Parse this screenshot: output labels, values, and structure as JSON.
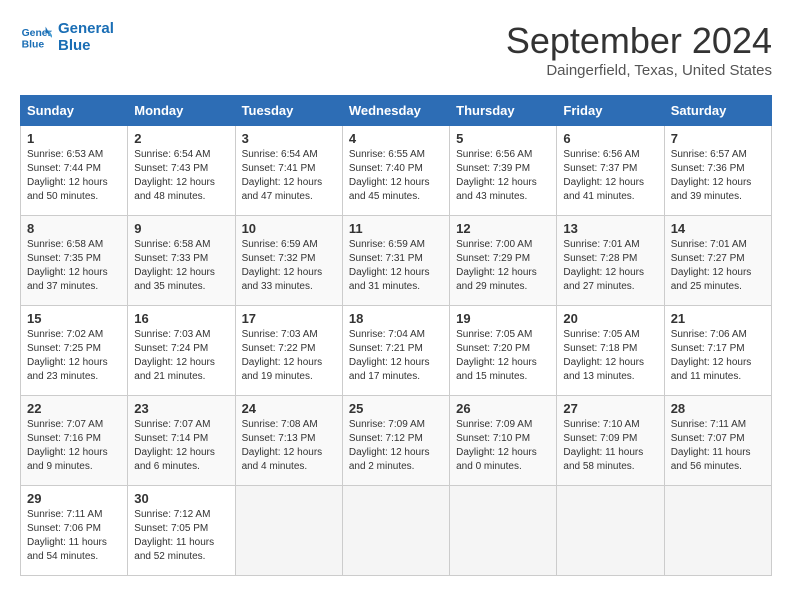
{
  "header": {
    "logo_line1": "General",
    "logo_line2": "Blue",
    "month_year": "September 2024",
    "location": "Daingerfield, Texas, United States"
  },
  "weekdays": [
    "Sunday",
    "Monday",
    "Tuesday",
    "Wednesday",
    "Thursday",
    "Friday",
    "Saturday"
  ],
  "weeks": [
    [
      {
        "day": "1",
        "sunrise": "Sunrise: 6:53 AM",
        "sunset": "Sunset: 7:44 PM",
        "daylight": "Daylight: 12 hours and 50 minutes."
      },
      {
        "day": "2",
        "sunrise": "Sunrise: 6:54 AM",
        "sunset": "Sunset: 7:43 PM",
        "daylight": "Daylight: 12 hours and 48 minutes."
      },
      {
        "day": "3",
        "sunrise": "Sunrise: 6:54 AM",
        "sunset": "Sunset: 7:41 PM",
        "daylight": "Daylight: 12 hours and 47 minutes."
      },
      {
        "day": "4",
        "sunrise": "Sunrise: 6:55 AM",
        "sunset": "Sunset: 7:40 PM",
        "daylight": "Daylight: 12 hours and 45 minutes."
      },
      {
        "day": "5",
        "sunrise": "Sunrise: 6:56 AM",
        "sunset": "Sunset: 7:39 PM",
        "daylight": "Daylight: 12 hours and 43 minutes."
      },
      {
        "day": "6",
        "sunrise": "Sunrise: 6:56 AM",
        "sunset": "Sunset: 7:37 PM",
        "daylight": "Daylight: 12 hours and 41 minutes."
      },
      {
        "day": "7",
        "sunrise": "Sunrise: 6:57 AM",
        "sunset": "Sunset: 7:36 PM",
        "daylight": "Daylight: 12 hours and 39 minutes."
      }
    ],
    [
      {
        "day": "8",
        "sunrise": "Sunrise: 6:58 AM",
        "sunset": "Sunset: 7:35 PM",
        "daylight": "Daylight: 12 hours and 37 minutes."
      },
      {
        "day": "9",
        "sunrise": "Sunrise: 6:58 AM",
        "sunset": "Sunset: 7:33 PM",
        "daylight": "Daylight: 12 hours and 35 minutes."
      },
      {
        "day": "10",
        "sunrise": "Sunrise: 6:59 AM",
        "sunset": "Sunset: 7:32 PM",
        "daylight": "Daylight: 12 hours and 33 minutes."
      },
      {
        "day": "11",
        "sunrise": "Sunrise: 6:59 AM",
        "sunset": "Sunset: 7:31 PM",
        "daylight": "Daylight: 12 hours and 31 minutes."
      },
      {
        "day": "12",
        "sunrise": "Sunrise: 7:00 AM",
        "sunset": "Sunset: 7:29 PM",
        "daylight": "Daylight: 12 hours and 29 minutes."
      },
      {
        "day": "13",
        "sunrise": "Sunrise: 7:01 AM",
        "sunset": "Sunset: 7:28 PM",
        "daylight": "Daylight: 12 hours and 27 minutes."
      },
      {
        "day": "14",
        "sunrise": "Sunrise: 7:01 AM",
        "sunset": "Sunset: 7:27 PM",
        "daylight": "Daylight: 12 hours and 25 minutes."
      }
    ],
    [
      {
        "day": "15",
        "sunrise": "Sunrise: 7:02 AM",
        "sunset": "Sunset: 7:25 PM",
        "daylight": "Daylight: 12 hours and 23 minutes."
      },
      {
        "day": "16",
        "sunrise": "Sunrise: 7:03 AM",
        "sunset": "Sunset: 7:24 PM",
        "daylight": "Daylight: 12 hours and 21 minutes."
      },
      {
        "day": "17",
        "sunrise": "Sunrise: 7:03 AM",
        "sunset": "Sunset: 7:22 PM",
        "daylight": "Daylight: 12 hours and 19 minutes."
      },
      {
        "day": "18",
        "sunrise": "Sunrise: 7:04 AM",
        "sunset": "Sunset: 7:21 PM",
        "daylight": "Daylight: 12 hours and 17 minutes."
      },
      {
        "day": "19",
        "sunrise": "Sunrise: 7:05 AM",
        "sunset": "Sunset: 7:20 PM",
        "daylight": "Daylight: 12 hours and 15 minutes."
      },
      {
        "day": "20",
        "sunrise": "Sunrise: 7:05 AM",
        "sunset": "Sunset: 7:18 PM",
        "daylight": "Daylight: 12 hours and 13 minutes."
      },
      {
        "day": "21",
        "sunrise": "Sunrise: 7:06 AM",
        "sunset": "Sunset: 7:17 PM",
        "daylight": "Daylight: 12 hours and 11 minutes."
      }
    ],
    [
      {
        "day": "22",
        "sunrise": "Sunrise: 7:07 AM",
        "sunset": "Sunset: 7:16 PM",
        "daylight": "Daylight: 12 hours and 9 minutes."
      },
      {
        "day": "23",
        "sunrise": "Sunrise: 7:07 AM",
        "sunset": "Sunset: 7:14 PM",
        "daylight": "Daylight: 12 hours and 6 minutes."
      },
      {
        "day": "24",
        "sunrise": "Sunrise: 7:08 AM",
        "sunset": "Sunset: 7:13 PM",
        "daylight": "Daylight: 12 hours and 4 minutes."
      },
      {
        "day": "25",
        "sunrise": "Sunrise: 7:09 AM",
        "sunset": "Sunset: 7:12 PM",
        "daylight": "Daylight: 12 hours and 2 minutes."
      },
      {
        "day": "26",
        "sunrise": "Sunrise: 7:09 AM",
        "sunset": "Sunset: 7:10 PM",
        "daylight": "Daylight: 12 hours and 0 minutes."
      },
      {
        "day": "27",
        "sunrise": "Sunrise: 7:10 AM",
        "sunset": "Sunset: 7:09 PM",
        "daylight": "Daylight: 11 hours and 58 minutes."
      },
      {
        "day": "28",
        "sunrise": "Sunrise: 7:11 AM",
        "sunset": "Sunset: 7:07 PM",
        "daylight": "Daylight: 11 hours and 56 minutes."
      }
    ],
    [
      {
        "day": "29",
        "sunrise": "Sunrise: 7:11 AM",
        "sunset": "Sunset: 7:06 PM",
        "daylight": "Daylight: 11 hours and 54 minutes."
      },
      {
        "day": "30",
        "sunrise": "Sunrise: 7:12 AM",
        "sunset": "Sunset: 7:05 PM",
        "daylight": "Daylight: 11 hours and 52 minutes."
      },
      null,
      null,
      null,
      null,
      null
    ]
  ]
}
